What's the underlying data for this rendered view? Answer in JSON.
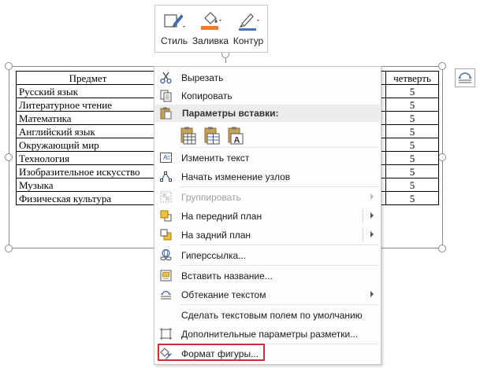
{
  "mini_toolbar": {
    "style_label": "Стиль",
    "fill_label": "Заливка",
    "outline_label": "Контур",
    "fill_color": "#ed7d31",
    "outline_color": "#4472c4"
  },
  "table": {
    "header_subject": "Предмет",
    "header_quarter": "четверть",
    "rows": [
      {
        "subject": "Русский язык",
        "value": "5"
      },
      {
        "subject": "Литературное чтение",
        "value": "5"
      },
      {
        "subject": "Математика",
        "value": "5"
      },
      {
        "subject": "Английский язык",
        "value": "5"
      },
      {
        "subject": "Окружающий мир",
        "value": "5"
      },
      {
        "subject": "Технология",
        "value": "5"
      },
      {
        "subject": "Изобразительное искусство",
        "value": "5"
      },
      {
        "subject": "Музыка",
        "value": "5"
      },
      {
        "subject": "Физическая культура",
        "value": "5"
      }
    ]
  },
  "context_menu": {
    "cut": "Вырезать",
    "copy": "Копировать",
    "paste_options": "Параметры вставки:",
    "edit_text": "Изменить текст",
    "edit_points": "Начать изменение узлов",
    "group": "Группировать",
    "bring_forward": "На передний план",
    "send_backward": "На задний план",
    "hyperlink": "Гиперссылка...",
    "insert_caption": "Вставить название...",
    "wrap_text": "Обтекание текстом",
    "set_default_textbox": "Сделать текстовым полем по умолчанию",
    "more_layout_options": "Дополнительные параметры разметки...",
    "format_shape": "Формат фигуры..."
  },
  "highlight_color": "#cf2c36"
}
